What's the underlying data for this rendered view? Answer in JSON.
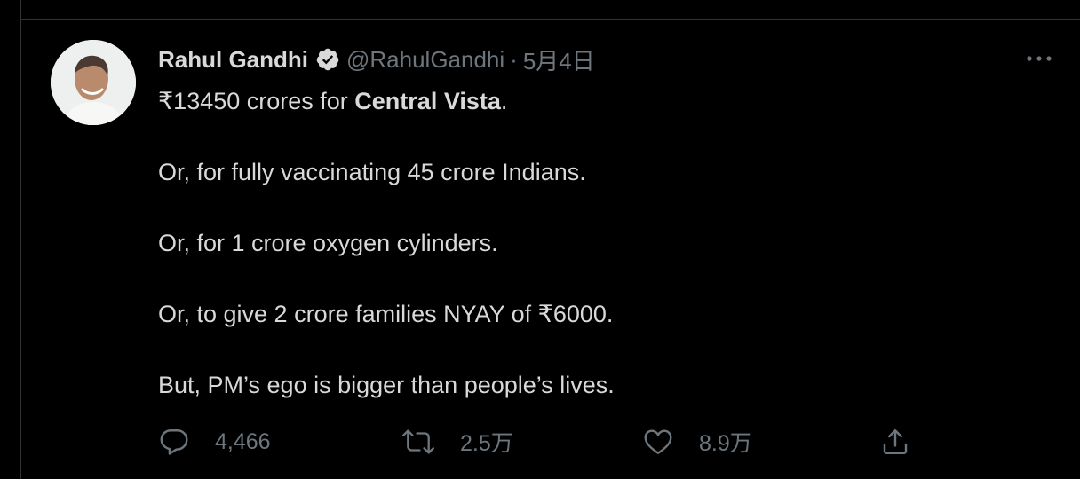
{
  "tweet": {
    "author_name": "Rahul Gandhi",
    "handle": "@RahulGandhi",
    "separator": "·",
    "date": "5月4日",
    "body": {
      "line1_prefix": "₹13450 crores for ",
      "line1_bold": "Central Vista",
      "line1_suffix": ".",
      "line2": "Or, for fully vaccinating 45 crore Indians.",
      "line3": "Or, for 1 crore oxygen cylinders.",
      "line4": "Or, to give 2 crore families NYAY of ₹6000.",
      "line5": "But, PM’s ego is bigger than people’s lives."
    },
    "actions": {
      "reply_count": "4,466",
      "retweet_count": "2.5万",
      "like_count": "8.9万"
    }
  },
  "icons": {
    "verified": "verified-badge-icon",
    "more": "more-dots-icon",
    "reply": "reply-bubble-icon",
    "retweet": "retweet-arrows-icon",
    "like": "heart-icon",
    "share": "share-upload-icon"
  },
  "colors": {
    "background": "#000000",
    "text_primary": "#d9d9d9",
    "text_secondary": "#6e767d",
    "divider": "#2f3336"
  }
}
